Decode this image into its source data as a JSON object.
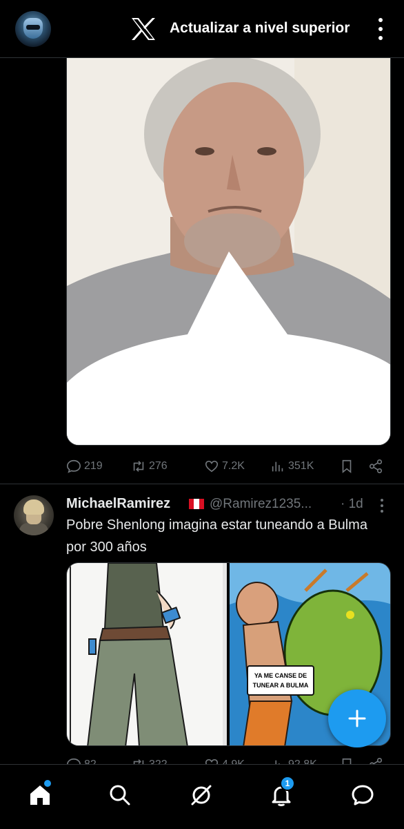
{
  "header": {
    "upgrade_label": "Actualizar a nivel superior"
  },
  "tweet1": {
    "metrics": {
      "replies": "219",
      "retweets": "276",
      "likes": "7.2K",
      "views": "351K"
    }
  },
  "tweet2": {
    "name": "MichaelRamirez",
    "handle": "@Ramirez1235...",
    "time": "· 1d",
    "text": "Pobre Shenlong imagina estar tuneando a Bulma por 300 años",
    "media_speech": "YA ME CANSE DE TUNEAR A BULMA",
    "metrics": {
      "replies": "82",
      "retweets": "322",
      "likes": "4.9K",
      "views": "92.8K"
    }
  },
  "nav": {
    "notifications_badge": "1"
  },
  "colors": {
    "accent": "#1d9bf0",
    "background": "#000000",
    "muted": "#71767b",
    "text": "#e7e9ea",
    "border": "#2f3336"
  },
  "icons": [
    "x-logo-icon",
    "more-vertical-icon",
    "reply-icon",
    "retweet-icon",
    "like-icon",
    "views-icon",
    "bookmark-icon",
    "share-icon",
    "plus-icon",
    "home-icon",
    "search-icon",
    "grok-icon",
    "bell-icon",
    "messages-icon"
  ]
}
